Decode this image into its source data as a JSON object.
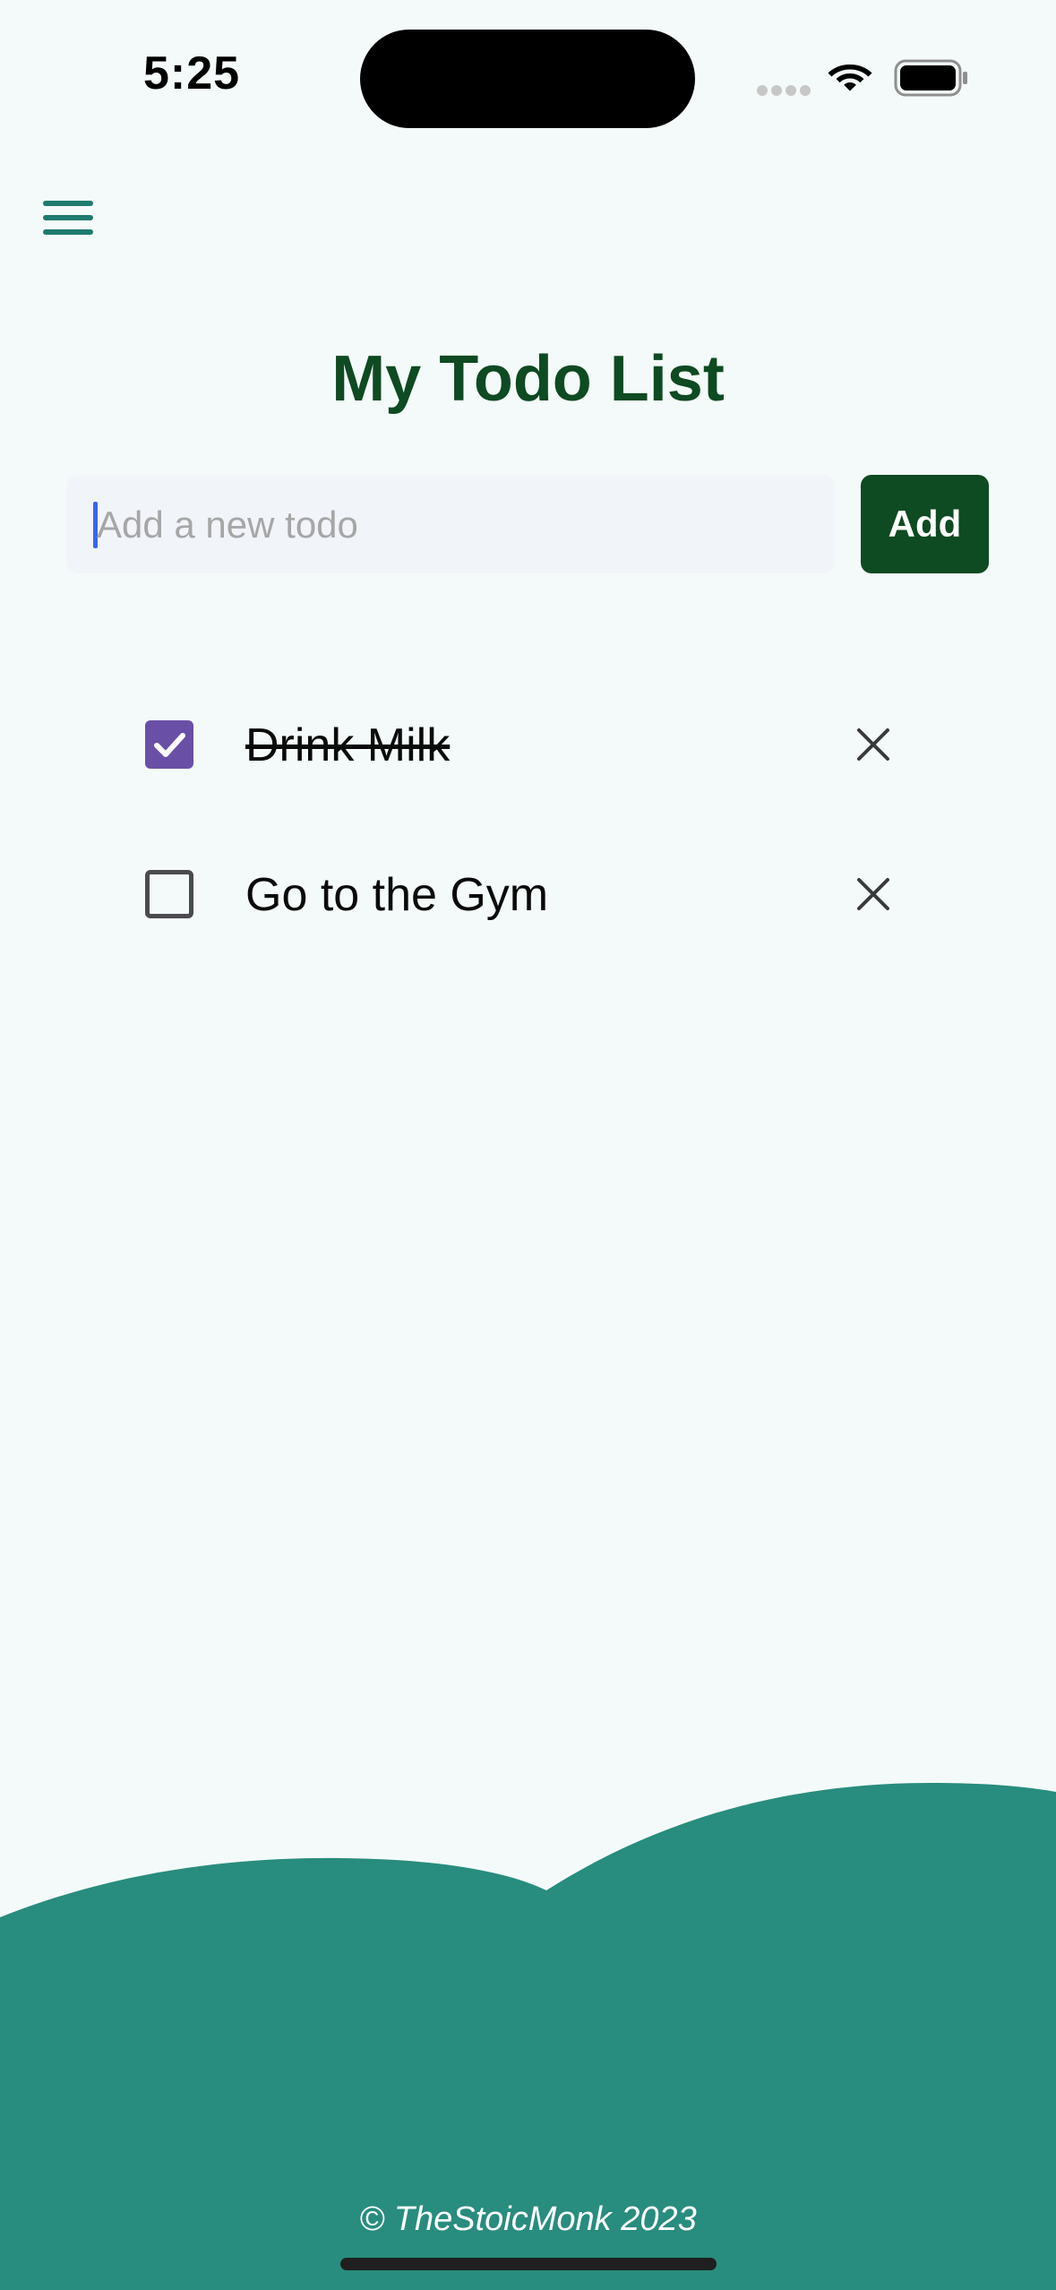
{
  "status_bar": {
    "time": "5:25"
  },
  "header": {
    "menu_icon": "hamburger-menu-icon",
    "title": "My Todo List"
  },
  "new_todo": {
    "placeholder": "Add a new todo",
    "value": "",
    "add_label": "Add"
  },
  "todos": [
    {
      "text": "Drink Milk",
      "completed": true
    },
    {
      "text": "Go to the Gym",
      "completed": false
    }
  ],
  "footer": {
    "text": "© TheStoicMonk 2023"
  },
  "colors": {
    "background": "#f4faf9",
    "title": "#0e4a22",
    "add_button": "#0e4a22",
    "checkbox_checked": "#6a4fa6",
    "footer_wave": "#288c7e",
    "menu_icon": "#1f7a6f"
  }
}
